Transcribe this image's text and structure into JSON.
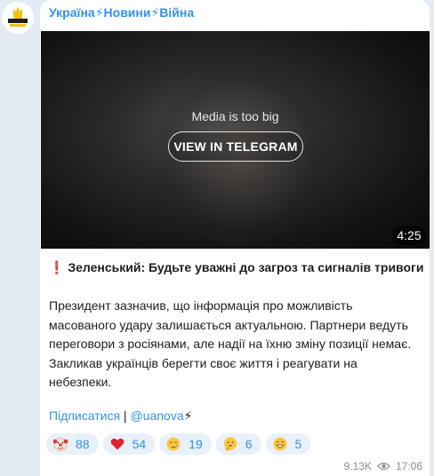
{
  "channel": {
    "name": "Україна⚡Новини⚡Війна",
    "avatar_text": "УКРАЇНА НОВИНИ"
  },
  "media": {
    "notice": "Media is too big",
    "view_button": "VIEW IN TELEGRAM",
    "duration": "4:25"
  },
  "post": {
    "headline_mark": "❗",
    "headline": "Зеленський: Будьте уважні до загроз та сигналів тривоги",
    "body_lines": [
      "Президент зазначив, що інформація про можливість",
      "масованого удару залишається актуальною. Партнери ведуть",
      "переговори з росіянами, але надії на їхню зміну позиції немає.",
      "Закликав українців берегти своє життя і реагувати на",
      "небезпеки."
    ],
    "subscribe_link": "Підписатися",
    "separator": " | ",
    "handle_link": "@uanova",
    "handle_suffix": "⚡"
  },
  "reactions": [
    {
      "emoji": "clown-face-icon",
      "count": "88"
    },
    {
      "emoji": "red-heart-icon",
      "count": "54"
    },
    {
      "emoji": "crying-face-icon",
      "count": "19"
    },
    {
      "emoji": "thinking-face-icon",
      "count": "6"
    },
    {
      "emoji": "grinning-face-icon",
      "count": "5"
    }
  ],
  "meta": {
    "views": "9.13K",
    "time": "17:06"
  },
  "colors": {
    "accent": "#3390ec",
    "background": "#e3ecf3",
    "reaction_bg": "#e8f1fa"
  }
}
